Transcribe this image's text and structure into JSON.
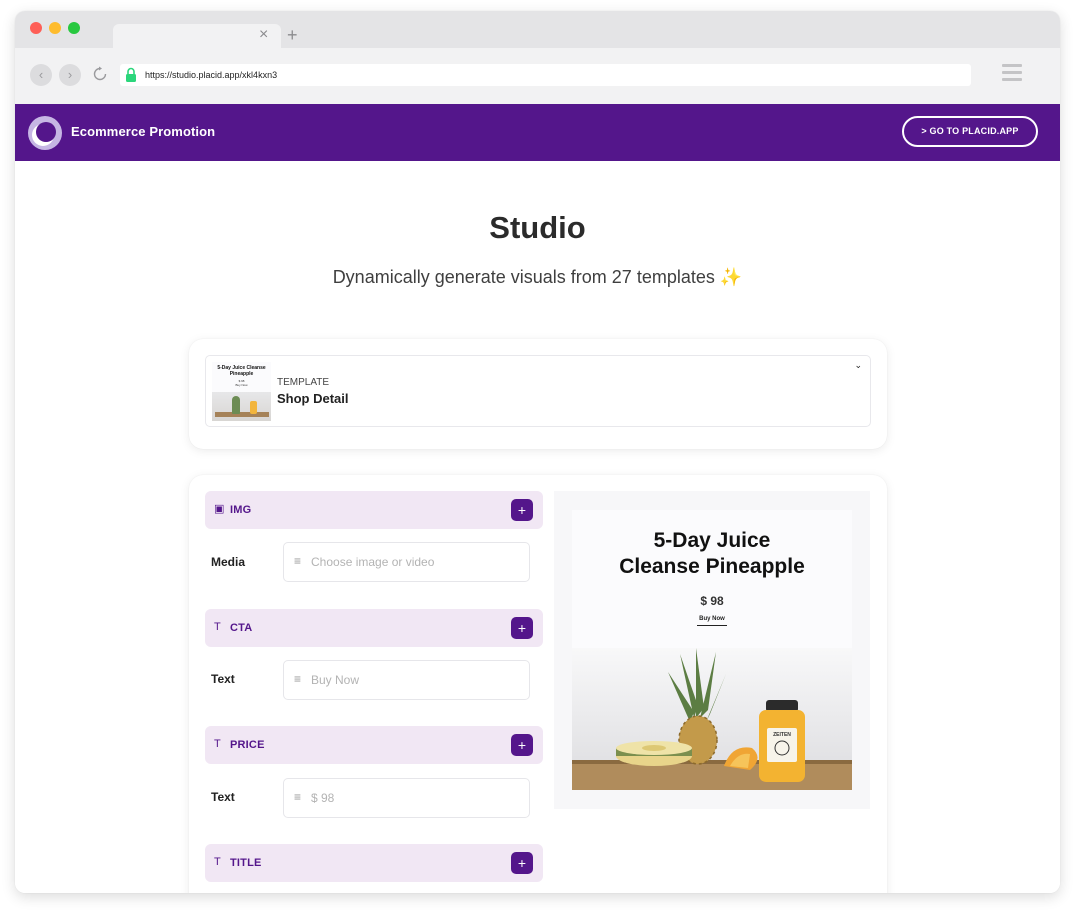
{
  "browser": {
    "url": "https://studio.placid.app/xkl4kxn3",
    "tab_close_glyph": "×",
    "tab_new_glyph": "+",
    "back_glyph": "‹",
    "forward_glyph": "›"
  },
  "appbar": {
    "title": "Ecommerce Promotion",
    "cta_label": "> GO TO PLACID.APP",
    "color": "#54168b"
  },
  "page": {
    "title": "Studio",
    "subtitle": "Dynamically generate visuals from 27 templates",
    "subtitle_emoji": "✨"
  },
  "template_selector": {
    "label": "TEMPLATE",
    "name": "Shop Detail",
    "thumbnail": {
      "title": "5-Day Juice Cleanse Pineapple",
      "price": "$ 98",
      "cta": "Buy Now"
    },
    "chevron_glyph": "⌄"
  },
  "layers": [
    {
      "icon": "image-icon",
      "icon_glyph": "▣",
      "name": "IMG",
      "add_glyph": "+",
      "field_label": "Media",
      "field_placeholder": "Choose image or video",
      "field_glyph": "≡"
    },
    {
      "icon": "text-icon",
      "icon_glyph": "T",
      "name": "CTA",
      "add_glyph": "+",
      "field_label": "Text",
      "field_placeholder": "Buy Now",
      "field_glyph": "≡"
    },
    {
      "icon": "text-icon",
      "icon_glyph": "T",
      "name": "PRICE",
      "add_glyph": "+",
      "field_label": "Text",
      "field_placeholder": "$ 98",
      "field_glyph": "≡"
    },
    {
      "icon": "text-icon",
      "icon_glyph": "T",
      "name": "TITLE",
      "add_glyph": "+"
    }
  ],
  "preview": {
    "title_line1": "5-Day Juice",
    "title_line2": "Cleanse Pineapple",
    "price": "$ 98",
    "cta": "Buy Now",
    "jar_label": "ZEITEN"
  },
  "colors": {
    "accent": "#54168b",
    "layer_header_bg": "#f1e7f4",
    "traffic_red": "#fe5f57",
    "traffic_yellow": "#febc2e",
    "traffic_green": "#28c840",
    "lock_green": "#2bd67b"
  }
}
